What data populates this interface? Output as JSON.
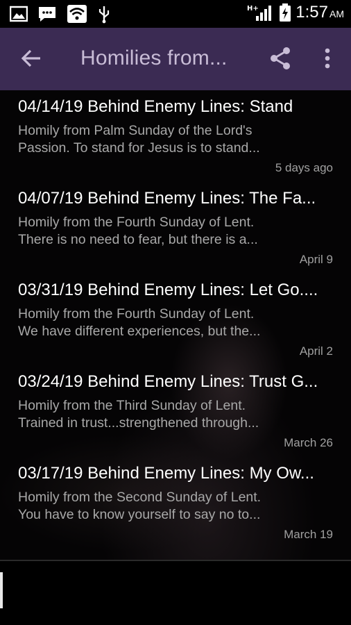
{
  "status_bar": {
    "time": "1:57",
    "ampm": "AM",
    "network": "H+"
  },
  "app_bar": {
    "title": "Homilies from..."
  },
  "items": [
    {
      "title": "04/14/19 Behind Enemy Lines: Stand",
      "desc_line1": "Homily from Palm Sunday of the Lord's",
      "desc_line2": "Passion. To stand for Jesus is to stand...",
      "date": "5 days ago"
    },
    {
      "title": "04/07/19 Behind Enemy Lines: The Fa...",
      "desc_line1": "Homily from the Fourth Sunday of Lent.",
      "desc_line2": "There is no need to fear, but there is a...",
      "date": "April 9"
    },
    {
      "title": "03/31/19 Behind Enemy Lines: Let Go....",
      "desc_line1": "Homily from the Fourth Sunday of Lent.",
      "desc_line2": "We have different experiences, but the...",
      "date": "April 2"
    },
    {
      "title": "03/24/19 Behind Enemy Lines: Trust G...",
      "desc_line1": "Homily from the Third Sunday of Lent.",
      "desc_line2": "Trained in trust...strengthened through...",
      "date": "March 26"
    },
    {
      "title": "03/17/19 Behind Enemy Lines: My Ow...",
      "desc_line1": "Homily from the Second Sunday of Lent.",
      "desc_line2": "You have to know yourself to say no to...",
      "date": "March 19"
    }
  ],
  "colors": {
    "app_bar_bg": "#3b2b53",
    "title_color": "#c8bcd6",
    "text_primary": "#ffffff",
    "text_secondary": "#a8a8a8"
  }
}
